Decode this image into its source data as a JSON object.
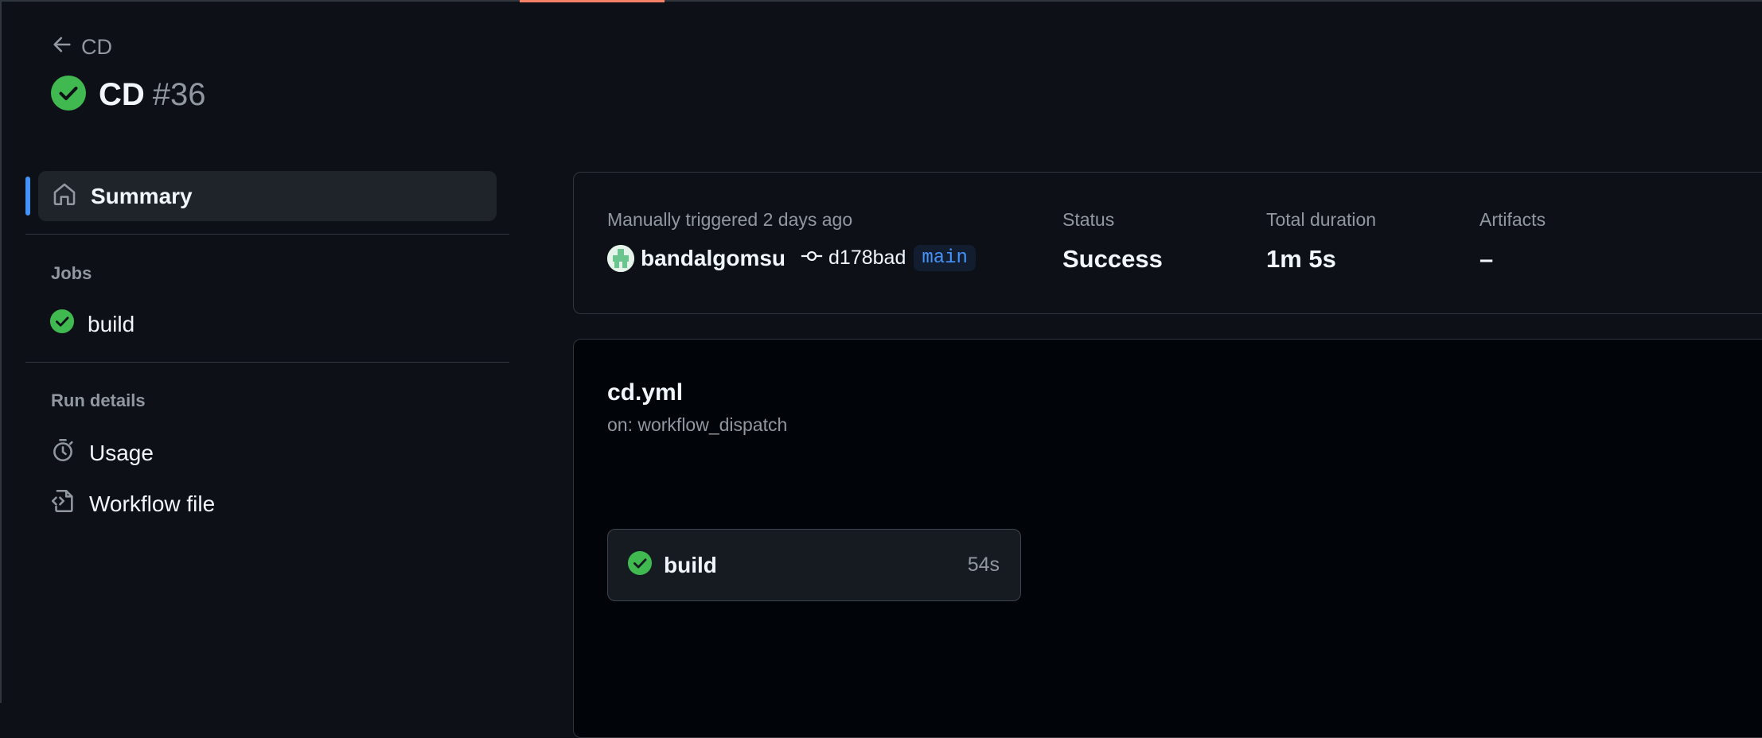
{
  "back_link": {
    "label": "CD"
  },
  "run": {
    "workflow": "CD",
    "number": "#36",
    "status_color": "#3fb950"
  },
  "sidebar": {
    "summary_label": "Summary",
    "jobs_heading": "Jobs",
    "jobs": [
      {
        "label": "build",
        "status": "success"
      }
    ],
    "run_details_heading": "Run details",
    "run_details": [
      {
        "label": "Usage",
        "icon": "stopwatch-icon"
      },
      {
        "label": "Workflow file",
        "icon": "file-code-icon"
      }
    ]
  },
  "summary": {
    "trigger_text": "Manually triggered 2 days ago",
    "actor": "bandalgomsu",
    "commit_sha": "d178bad",
    "branch": "main",
    "status_label": "Status",
    "status_value": "Success",
    "duration_label": "Total duration",
    "duration_value": "1m 5s",
    "artifacts_label": "Artifacts",
    "artifacts_value": "–"
  },
  "workflow": {
    "file": "cd.yml",
    "trigger": "on: workflow_dispatch",
    "job": {
      "label": "build",
      "duration": "54s"
    }
  },
  "colors": {
    "accent": "#4493f8",
    "success": "#3fb950",
    "tab_accent": "#f78166"
  }
}
